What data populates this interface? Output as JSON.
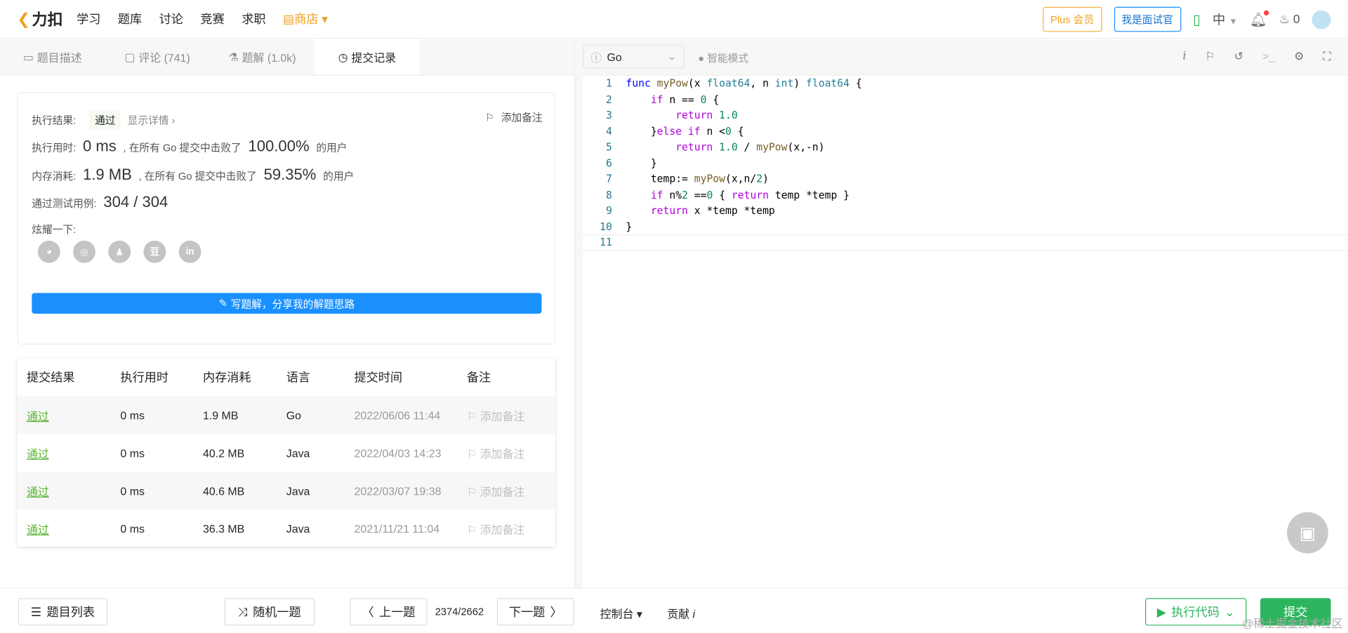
{
  "header": {
    "logo": "力扣",
    "nav": [
      "学习",
      "题库",
      "讨论",
      "竞赛",
      "求职"
    ],
    "shop": "商店",
    "plus": "Plus 会员",
    "interviewer": "我是面试官",
    "lang": "中",
    "points": "0"
  },
  "tabs": [
    {
      "label": "题目描述",
      "icon": "description-icon"
    },
    {
      "label": "评论 (741)",
      "icon": "comment-icon"
    },
    {
      "label": "题解 (1.0k)",
      "icon": "flask-icon"
    },
    {
      "label": "提交记录",
      "icon": "clock-icon",
      "active": true
    }
  ],
  "editor": {
    "language": "Go",
    "mode": "智能模式",
    "code": [
      [
        [
          "k",
          "func "
        ],
        [
          "f",
          "myPow"
        ],
        [
          "",
          "(x "
        ],
        [
          "t",
          "float64"
        ],
        [
          "",
          ", n "
        ],
        [
          "t",
          "int"
        ],
        [
          "",
          ") "
        ],
        [
          "t",
          "float64"
        ],
        [
          "",
          " {"
        ]
      ],
      [
        [
          "",
          "    "
        ],
        [
          "r",
          "if"
        ],
        [
          "",
          " n == "
        ],
        [
          "n",
          "0"
        ],
        [
          "",
          " {"
        ]
      ],
      [
        [
          "",
          "        "
        ],
        [
          "r",
          "return"
        ],
        [
          "",
          " "
        ],
        [
          "n",
          "1.0"
        ]
      ],
      [
        [
          "",
          "    }"
        ],
        [
          "r",
          "else if"
        ],
        [
          "",
          " n <"
        ],
        [
          "n",
          "0"
        ],
        [
          "",
          " {"
        ]
      ],
      [
        [
          "",
          "        "
        ],
        [
          "r",
          "return"
        ],
        [
          "",
          " "
        ],
        [
          "n",
          "1.0"
        ],
        [
          "",
          " / "
        ],
        [
          "f",
          "myPow"
        ],
        [
          "",
          "(x,-n)"
        ]
      ],
      [
        [
          "",
          "    }"
        ]
      ],
      [
        [
          "",
          "    temp:= "
        ],
        [
          "f",
          "myPow"
        ],
        [
          "",
          "(x,n/"
        ],
        [
          "n",
          "2"
        ],
        [
          "",
          ")"
        ]
      ],
      [
        [
          "",
          "    "
        ],
        [
          "r",
          "if"
        ],
        [
          "",
          " n%"
        ],
        [
          "n",
          "2"
        ],
        [
          "",
          " =="
        ],
        [
          "n",
          "0"
        ],
        [
          "",
          " { "
        ],
        [
          "r",
          "return"
        ],
        [
          "",
          " temp *temp }"
        ]
      ],
      [
        [
          "",
          "    "
        ],
        [
          "r",
          "return"
        ],
        [
          "",
          " x *temp *temp"
        ]
      ],
      [
        [
          "",
          "}"
        ]
      ],
      [
        [
          "",
          ""
        ]
      ]
    ]
  },
  "result": {
    "label": "执行结果:",
    "status": "通过",
    "details": "显示详情 ›",
    "add_note": "添加备注",
    "time_label": "执行用时:",
    "time": "0 ms",
    "time_text": ", 在所有 Go 提交中击败了",
    "time_pct": "100.00%",
    "users": "的用户",
    "mem_label": "内存消耗:",
    "mem": "1.9 MB",
    "mem_text": ", 在所有 Go 提交中击败了",
    "mem_pct": "59.35%",
    "cases_label": "通过测试用例:",
    "cases": "304 / 304",
    "share_label": "炫耀一下:",
    "write": "写题解，分享我的解题思路"
  },
  "table": {
    "headers": [
      "提交结果",
      "执行用时",
      "内存消耗",
      "语言",
      "提交时间",
      "备注"
    ],
    "rows": [
      [
        "通过",
        "0 ms",
        "1.9 MB",
        "Go",
        "2022/06/06 11:44",
        "添加备注"
      ],
      [
        "通过",
        "0 ms",
        "40.2 MB",
        "Java",
        "2022/04/03 14:23",
        "添加备注"
      ],
      [
        "通过",
        "0 ms",
        "40.6 MB",
        "Java",
        "2022/03/07 19:38",
        "添加备注"
      ],
      [
        "通过",
        "0 ms",
        "36.3 MB",
        "Java",
        "2021/11/21 11:04",
        "添加备注"
      ]
    ]
  },
  "footer": {
    "list": "题目列表",
    "random": "随机一题",
    "prev": "上一题",
    "page": "2374/2662",
    "next": "下一题",
    "console": "控制台 ▾",
    "contribute": "贡献",
    "run": "执行代码",
    "submit": "提交",
    "watermark": "@稀土掘金技术社区"
  },
  "colors": {
    "accent": "#1a90ff",
    "success": "#2db55d",
    "pass": "#5cb335",
    "shop": "#f0a020"
  }
}
